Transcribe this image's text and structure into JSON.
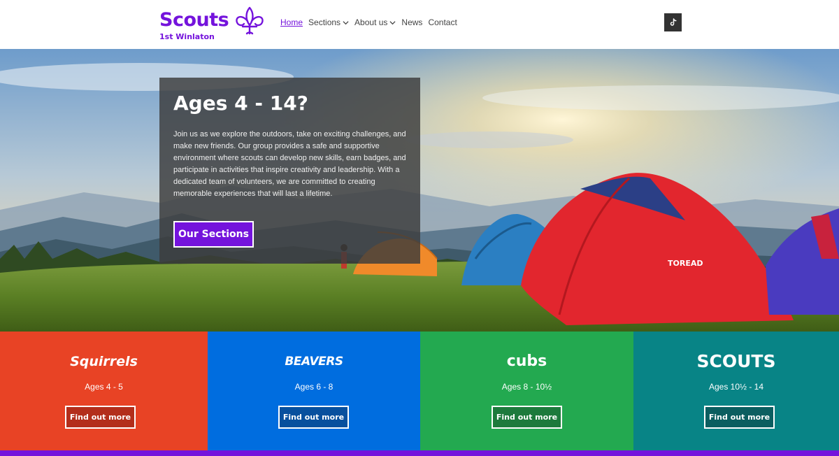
{
  "brand": {
    "name": "Scouts",
    "group": "1st Winlaton",
    "color": "#7413dc"
  },
  "nav": {
    "items": [
      {
        "label": "Home",
        "active": true,
        "dropdown": false
      },
      {
        "label": "Sections",
        "active": false,
        "dropdown": true
      },
      {
        "label": "About us",
        "active": false,
        "dropdown": true
      },
      {
        "label": "News",
        "active": false,
        "dropdown": false
      },
      {
        "label": "Contact",
        "active": false,
        "dropdown": false
      }
    ],
    "social_icon": "tiktok-icon"
  },
  "hero": {
    "title": "Ages 4 - 14?",
    "body": "Join us as we explore the outdoors, take on exciting challenges, and make new friends. Our group provides a safe and supportive environment where scouts can develop new skills, earn badges, and participate in activities that inspire creativity and leadership. With a dedicated team of volunteers, we are committed to creating memorable experiences that will last a lifetime.",
    "button_label": "Our Sections",
    "tent_brand": "TOREAD"
  },
  "sections": [
    {
      "name": "Squirrels",
      "ages": "Ages 4 - 5",
      "button": "Find out more",
      "color": "#e84325",
      "button_bg": "#b32e1b"
    },
    {
      "name": "BEAVERS",
      "ages": "Ages 6 - 8",
      "button": "Find out more",
      "color": "#006ddf",
      "button_bg": "#08509e"
    },
    {
      "name": "cubs",
      "ages": "Ages 8 - 10½",
      "button": "Find out more",
      "color": "#23a950",
      "button_bg": "#1d7a3c"
    },
    {
      "name": "SCOUTS",
      "ages": "Ages 10½ - 14",
      "button": "Find out more",
      "color": "#088486",
      "button_bg": "#0b5e60"
    }
  ]
}
